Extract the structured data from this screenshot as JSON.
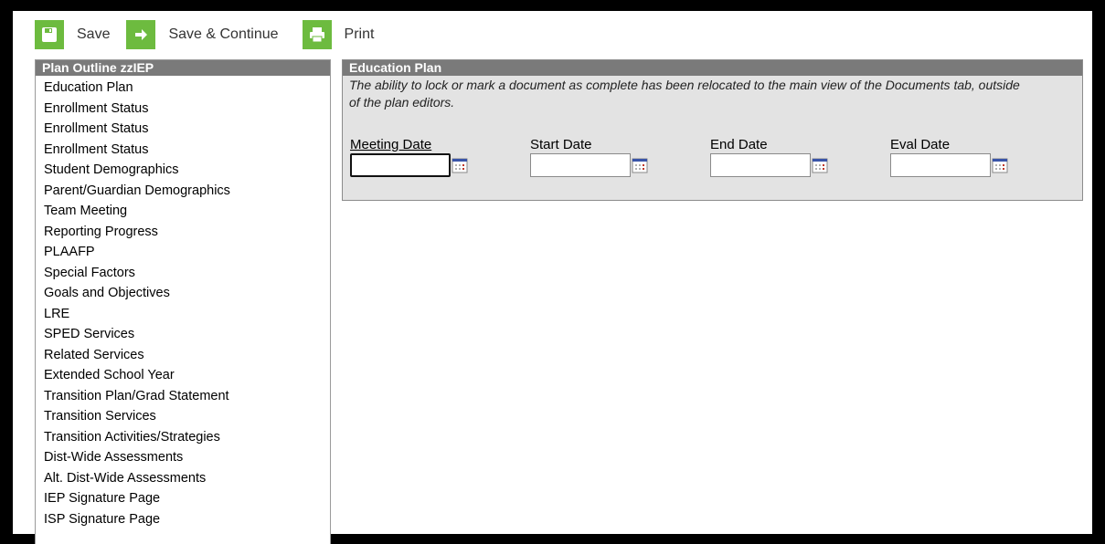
{
  "toolbar": {
    "save_label": "Save",
    "save_continue_label": "Save & Continue",
    "print_label": "Print"
  },
  "sidebar": {
    "title": "Plan Outline zzIEP",
    "items": [
      {
        "label": "Education Plan"
      },
      {
        "label": "Enrollment Status"
      },
      {
        "label": "Enrollment Status"
      },
      {
        "label": "Enrollment Status"
      },
      {
        "label": "Student Demographics"
      },
      {
        "label": "Parent/Guardian Demographics"
      },
      {
        "label": "Team Meeting"
      },
      {
        "label": "Reporting Progress"
      },
      {
        "label": "PLAAFP"
      },
      {
        "label": "Special Factors"
      },
      {
        "label": "Goals and Objectives"
      },
      {
        "label": "LRE"
      },
      {
        "label": "SPED Services"
      },
      {
        "label": "Related Services"
      },
      {
        "label": "Extended School Year"
      },
      {
        "label": "Transition Plan/Grad Statement"
      },
      {
        "label": "Transition Services"
      },
      {
        "label": "Transition Activities/Strategies"
      },
      {
        "label": "Dist-Wide Assessments"
      },
      {
        "label": "Alt. Dist-Wide Assessments"
      },
      {
        "label": "IEP Signature Page"
      },
      {
        "label": "ISP Signature Page"
      }
    ]
  },
  "panel": {
    "title": "Education Plan",
    "note": "The ability to lock or mark a document as complete has been relocated to the main view of the Documents tab, outside of the plan editors.",
    "fields": {
      "meeting_date": {
        "label": "Meeting Date",
        "value": ""
      },
      "start_date": {
        "label": "Start Date",
        "value": ""
      },
      "end_date": {
        "label": "End Date",
        "value": ""
      },
      "eval_date": {
        "label": "Eval Date",
        "value": ""
      }
    }
  },
  "icons": {
    "save": "floppy-icon",
    "save_continue": "arrow-right-icon",
    "print": "printer-icon",
    "calendar": "calendar-icon"
  },
  "colors": {
    "toolbar_icon_bg": "#6dbb3f",
    "header_bg": "#7a7a7a",
    "panel_bg": "#e3e3e3"
  }
}
